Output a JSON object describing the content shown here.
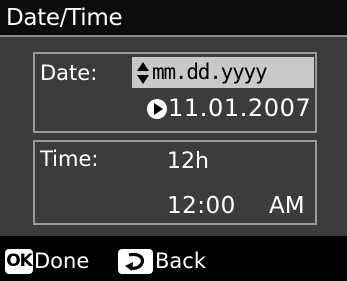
{
  "screen": {
    "title": "Date/Time"
  },
  "date_section": {
    "label": "Date:",
    "format_value": "mm.dd.yyyy",
    "format_arrow_icon": "up-down-arrow-icon",
    "date_value": "11.01.2007",
    "date_arrow_icon": "play-right-icon"
  },
  "time_section": {
    "label": "Time:",
    "mode_value": "12h",
    "time_value": "12:00",
    "ampm_value": "AM"
  },
  "footer": {
    "ok_key": "OK",
    "done_label": "Done",
    "back_key_icon": "back-return-icon",
    "back_label": "Back"
  }
}
